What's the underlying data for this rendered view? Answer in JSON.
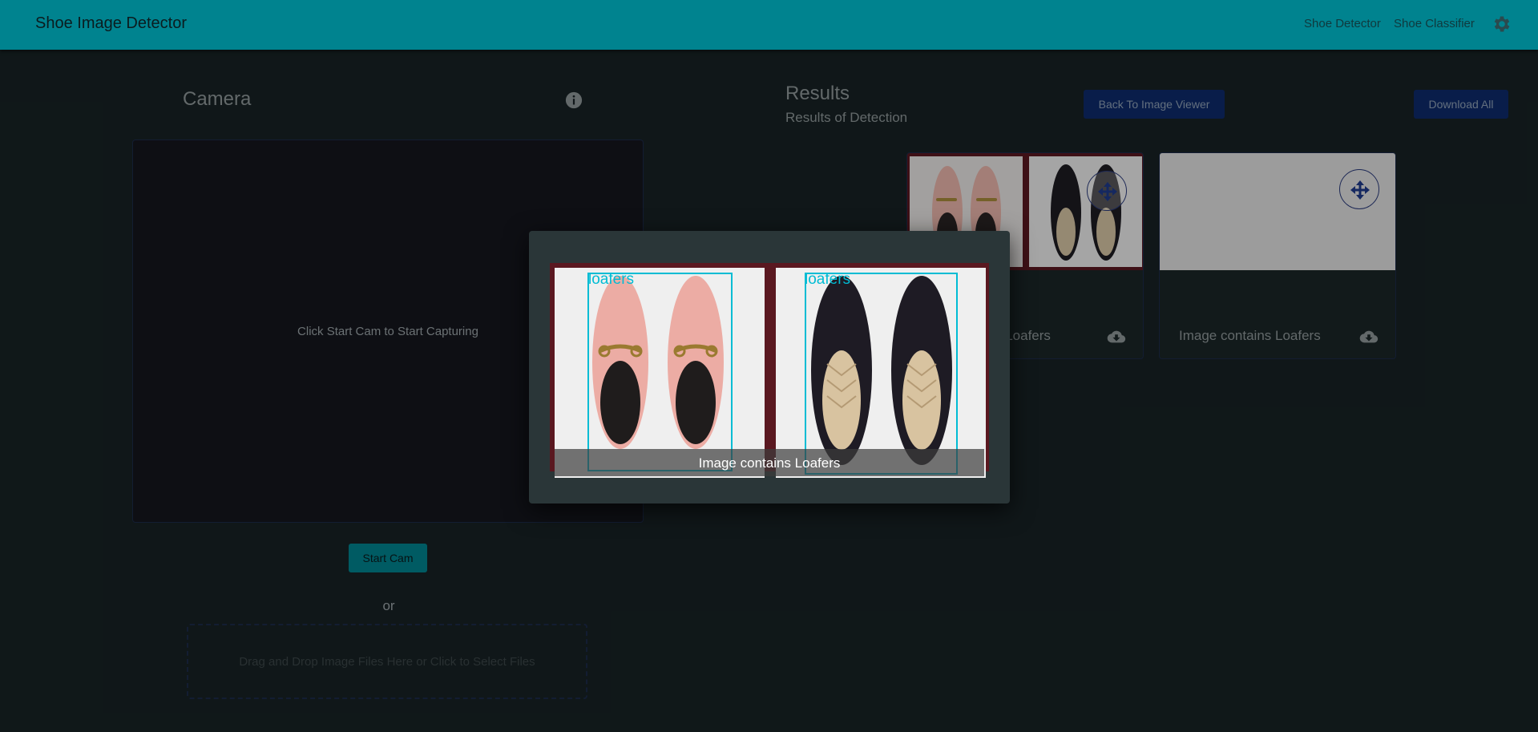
{
  "app": {
    "title": "Shoe Image Detector",
    "nav": [
      "Shoe Detector",
      "Shoe Classifier"
    ],
    "settings_icon": "gear-icon"
  },
  "camera": {
    "title": "Camera",
    "info_icon": "info-icon",
    "placeholder": "Click Start Cam to Start Capturing",
    "start_button": "Start Cam",
    "or_label": "or",
    "dropzone_text": "Drag and Drop Image Files Here or Click to Select Files"
  },
  "results": {
    "title": "Results",
    "subtitle": "Results of Detection",
    "back_button": "Back To Image Viewer",
    "download_all_button": "Download All",
    "cards": [
      {
        "caption": "Image contains Loafers",
        "visible_caption": "s Loafers",
        "download_icon": "cloud-download-icon",
        "move_icon": "move-icon"
      },
      {
        "caption": "Image contains Loafers",
        "download_icon": "cloud-download-icon",
        "move_icon": "move-icon"
      }
    ]
  },
  "modal": {
    "caption": "Image contains Loafers",
    "detections": [
      {
        "label": "loafers",
        "shoe_color": "pink"
      },
      {
        "label": "loafers",
        "shoe_color": "black"
      }
    ]
  },
  "colors": {
    "primary": "#00838f",
    "background": "#172224",
    "detection_box": "#00bcd4",
    "dark_button": "#0d2a6b"
  }
}
